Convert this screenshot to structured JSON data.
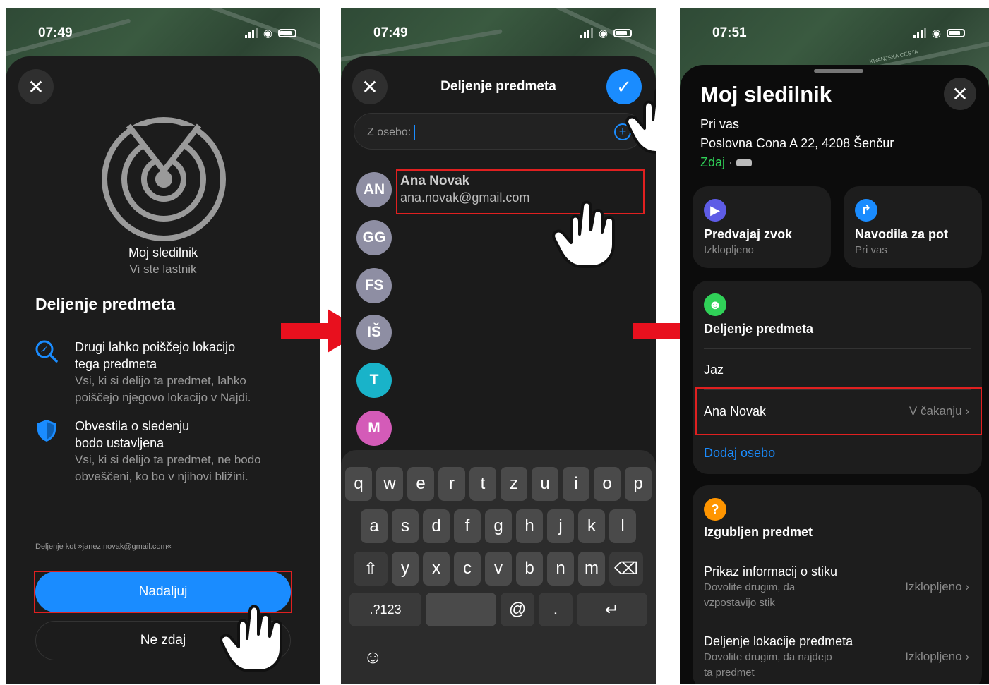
{
  "colors": {
    "accent": "#1a8cff",
    "highlight": "#e02020",
    "green": "#30d158",
    "orange": "#ff9500"
  },
  "panel1": {
    "time": "07:49",
    "item_name": "Moj sledilnik",
    "owner": "Vi ste lastnik",
    "heading": "Deljenje predmeta",
    "features": [
      {
        "icon": "search-location-icon",
        "title_lines": [
          "Drugi lahko poiščejo lokacijo",
          "tega predmeta"
        ],
        "desc_lines": [
          "Vsi, ki si delijo ta predmet, lahko",
          "poiščejo njegovo lokacijo v Najdi."
        ]
      },
      {
        "icon": "shield-icon",
        "title_lines": [
          "Obvestila o sledenju",
          "bodo ustavljena"
        ],
        "desc_lines": [
          "Vsi, ki si delijo ta predmet, ne bodo",
          "obveščeni, ko bo v njihovi bližini."
        ]
      }
    ],
    "share_as": "Deljenje kot »janez.novak@gmail.com«",
    "continue_label": "Nadaljuj",
    "not_now_label": "Ne zdaj"
  },
  "panel2": {
    "time": "07:49",
    "title": "Deljenje predmeta",
    "to_label": "Z osebo:",
    "contact": {
      "name": "Ana Novak",
      "email": "ana.novak@gmail.com"
    },
    "avatars": [
      {
        "initials": "AN",
        "color": "#8e8ea3"
      },
      {
        "initials": "GG",
        "color": "#8e8ea3"
      },
      {
        "initials": "FS",
        "color": "#8e8ea3"
      },
      {
        "initials": "IŠ",
        "color": "#8e8ea3"
      },
      {
        "initials": "T",
        "color": "#19b3c9"
      },
      {
        "initials": "M",
        "color": "#d45bb8"
      }
    ],
    "keyboard": {
      "row1": [
        "q",
        "w",
        "e",
        "r",
        "t",
        "z",
        "u",
        "i",
        "o",
        "p"
      ],
      "row2": [
        "a",
        "s",
        "d",
        "f",
        "g",
        "h",
        "j",
        "k",
        "l"
      ],
      "row3": [
        "y",
        "x",
        "c",
        "v",
        "b",
        "n",
        "m"
      ],
      "numbers_label": ".?123",
      "at_label": "@",
      "dot_label": "."
    }
  },
  "panel3": {
    "time": "07:51",
    "map_label": "KRANJSKA CESTA",
    "title": "Moj sledilnik",
    "location_title": "Pri vas",
    "address": "Poslovna Cona A 22, 4208 Šenčur",
    "updated": "Zdaj",
    "play_sound": {
      "title": "Predvajaj zvok",
      "sub": "Izklopljeno"
    },
    "directions": {
      "title": "Navodila za pot",
      "sub": "Pri vas"
    },
    "sharing": {
      "title": "Deljenje predmeta",
      "me": "Jaz",
      "person": "Ana Novak",
      "status": "V čakanju",
      "add_person": "Dodaj osebo"
    },
    "lost": {
      "title": "Izgubljen predmet",
      "contact_title": "Prikaz informacij o stiku",
      "contact_desc": [
        "Dovolite drugim, da",
        "vzpostavijo stik"
      ],
      "contact_value": "Izklopljeno",
      "location_title": "Deljenje lokacije predmeta",
      "location_desc": [
        "Dovolite drugim, da najdejo",
        "ta predmet"
      ],
      "location_value": "Izklopljeno"
    }
  }
}
